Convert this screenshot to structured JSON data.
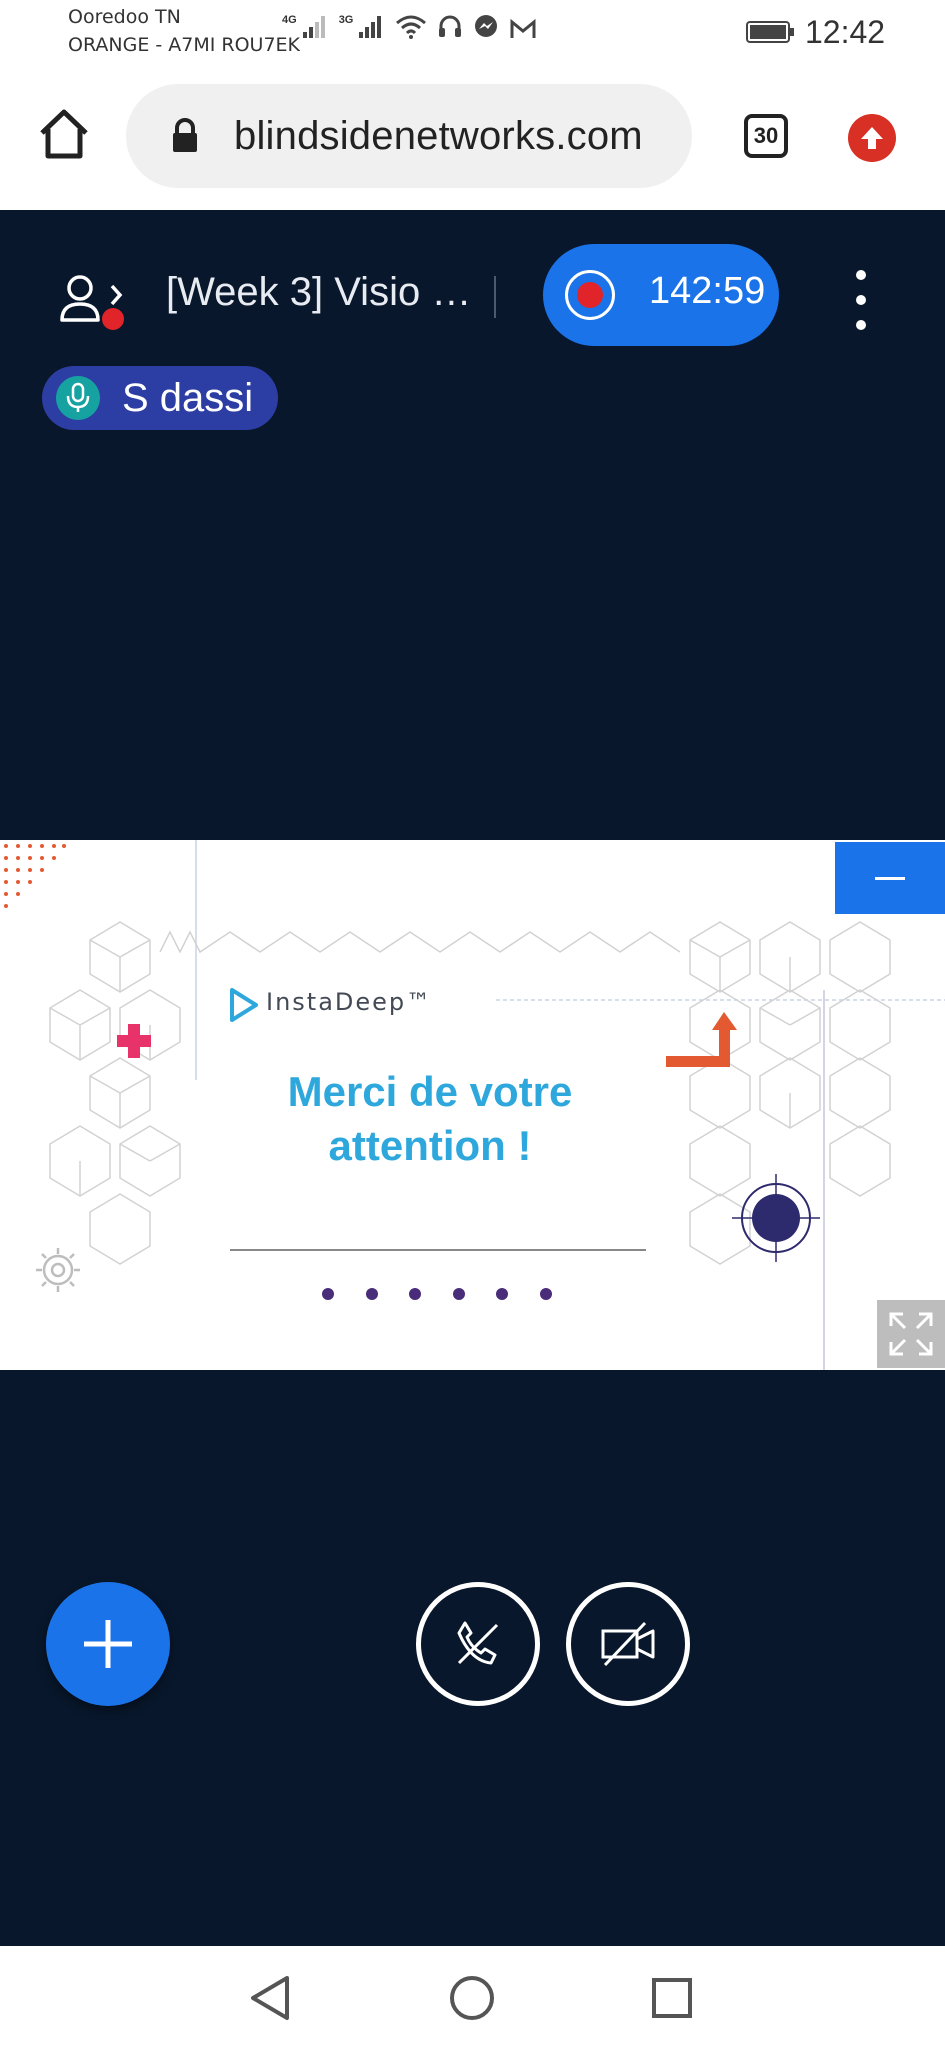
{
  "status_bar": {
    "carrier_primary": "Ooredoo TN",
    "carrier_secondary": "ORANGE - A7MI ROU7EK",
    "network_1": "4G",
    "network_2": "3G",
    "time": "12:42",
    "icons": [
      "signal-icon",
      "wifi-icon",
      "headphones-icon",
      "messenger-icon",
      "gmail-icon",
      "battery-icon"
    ]
  },
  "browser": {
    "url": "blindsidenetworks.com",
    "tab_count": "30"
  },
  "meeting": {
    "title": "[Week 3] Visio …",
    "recording_time": "142:59",
    "talker_name": "S dassi"
  },
  "slide": {
    "logo": "InstaDeep™",
    "line1": "Merci de votre",
    "line2": "attention !",
    "dot_count": 6
  },
  "colors": {
    "app_bg": "#08172b",
    "accent_blue": "#1a73e8",
    "record_red": "#e0242a",
    "slide_text": "#2ea8dc",
    "talker_pill": "#2c3ea3"
  }
}
